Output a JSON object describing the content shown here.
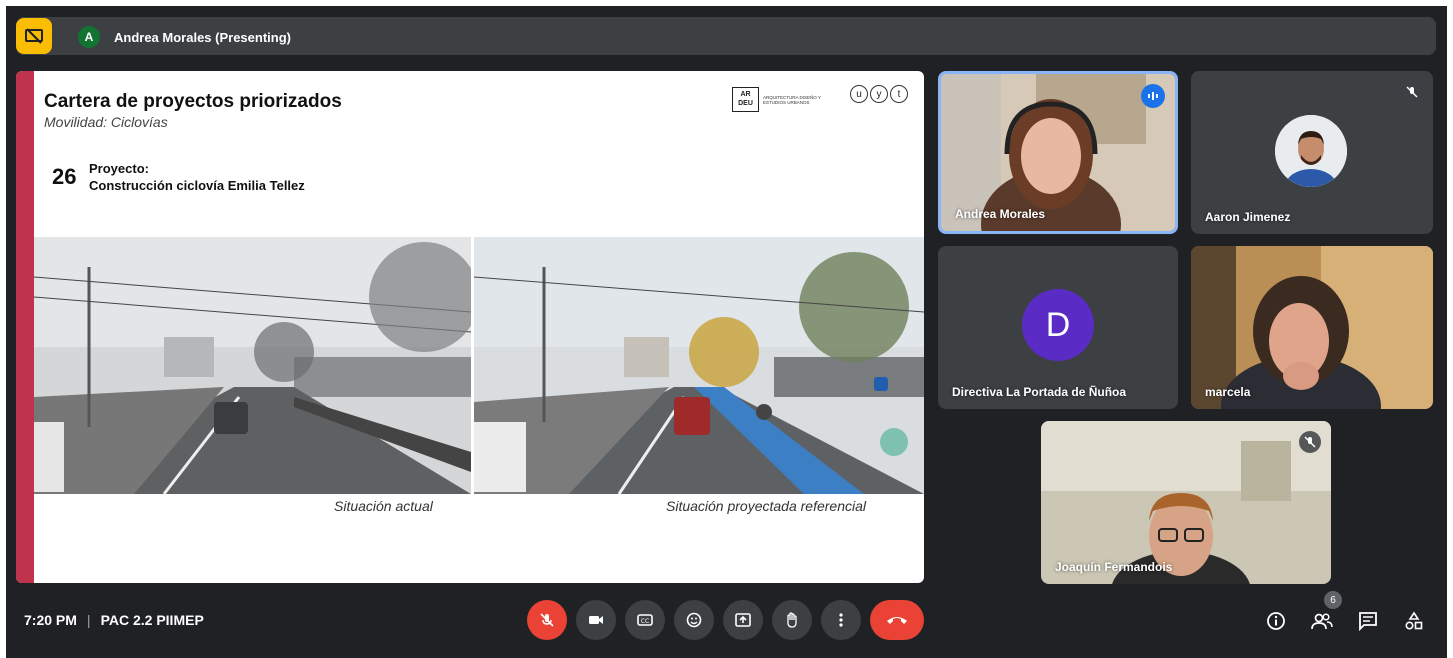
{
  "topbar": {
    "presenter_initial": "A",
    "presenter_label": "Andrea Morales (Presenting)"
  },
  "slide": {
    "title": "Cartera de proyectos priorizados",
    "subtitle": "Movilidad: Ciclovías",
    "project_number": "26",
    "project_label": "Proyecto:",
    "project_name": "Construcción ciclovía Emilia Tellez",
    "logo_ardeu_mark": "AR DEU",
    "logo_ardeu_text": "ARQUITECTURA DISEÑO Y ESTUDIOS URBANOS",
    "logo_uyt": [
      "u",
      "y",
      "t"
    ],
    "caption_left": "Situación actual",
    "caption_right": "Situación proyectada referencial"
  },
  "participants": [
    {
      "name": "Andrea Morales",
      "speaking": true
    },
    {
      "name": "Aaron Jimenez",
      "muted": true
    },
    {
      "name": "Directiva La Portada de Ñuñoa",
      "initial": "D"
    },
    {
      "name": "marcela"
    },
    {
      "name": "Joaquín Fermandois",
      "muted": true
    }
  ],
  "footer": {
    "time": "7:20 PM",
    "meeting_code": "PAC 2.2 PIIMEP",
    "participant_count": "6"
  },
  "colors": {
    "background": "#202124",
    "accent_red": "#ea4335",
    "present_yellow": "#fbbc04",
    "speaking_blue": "#8ab4f8",
    "slide_accent": "#c0334d"
  }
}
